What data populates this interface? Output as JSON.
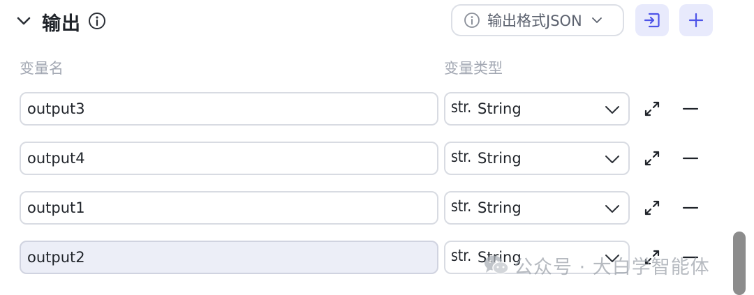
{
  "header": {
    "title": "输出",
    "format_button_label": "输出格式JSON"
  },
  "columns": {
    "name": "变量名",
    "type": "变量类型"
  },
  "rows": [
    {
      "name": "output3",
      "type_prefix": "str.",
      "type": "String"
    },
    {
      "name": "output4",
      "type_prefix": "str.",
      "type": "String"
    },
    {
      "name": "output1",
      "type_prefix": "str.",
      "type": "String"
    },
    {
      "name": "output2",
      "type_prefix": "str.",
      "type": "String"
    }
  ],
  "watermark": {
    "text": "公众号 · 大白学智能体"
  },
  "colors": {
    "accent": "#4d53e8",
    "button_bg": "#e8eafc",
    "border": "#d8dbe2",
    "muted_text": "#a3a8b3",
    "active_input_bg": "#eceef7",
    "scrollbar": "#8c8c8c"
  },
  "icons": {
    "collapse": "chevron-down-icon",
    "info": "info-icon",
    "import": "import-icon",
    "add": "plus-icon",
    "dropdown": "chevron-down-icon",
    "expand": "expand-icon",
    "remove": "minus-icon",
    "watermark": "wechat-icon"
  }
}
